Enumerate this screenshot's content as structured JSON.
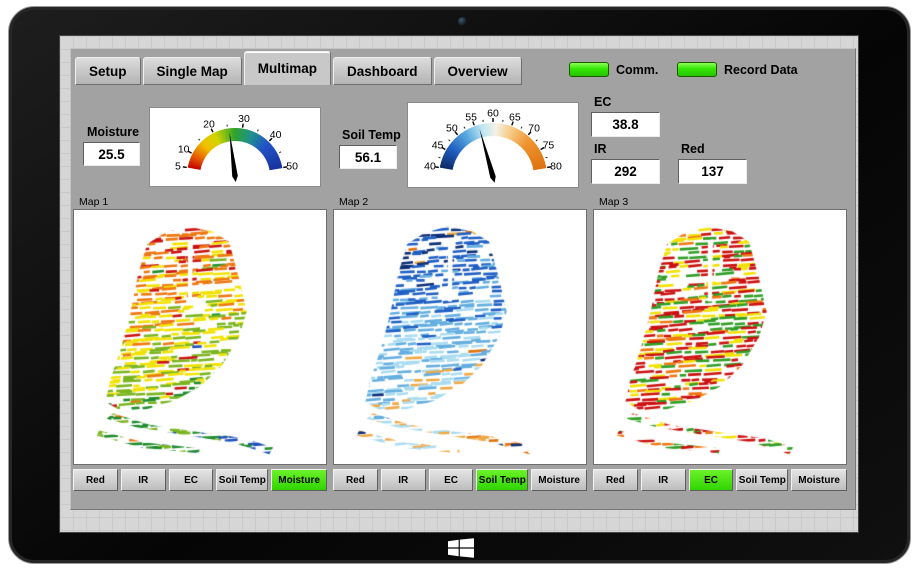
{
  "window": {
    "tabs": [
      {
        "label": "Setup"
      },
      {
        "label": "Single Map"
      },
      {
        "label": "Multimap"
      },
      {
        "label": "Dashboard"
      },
      {
        "label": "Overview"
      }
    ],
    "active_tab_index": 2
  },
  "indicators": [
    {
      "label": "Comm.",
      "state": "on",
      "color": "#33e604"
    },
    {
      "label": "Record Data",
      "state": "on",
      "color": "#33e604"
    }
  ],
  "readouts": {
    "moisture": {
      "label": "Moisture",
      "value": "25.5"
    },
    "soil_temp": {
      "label": "Soil Temp",
      "value": "56.1"
    },
    "ec": {
      "label": "EC",
      "value": "38.8"
    },
    "ir": {
      "label": "IR",
      "value": "292"
    },
    "red": {
      "label": "Red",
      "value": "137"
    }
  },
  "gauges": [
    {
      "id": "moisture-gauge",
      "min": 5,
      "max": 50,
      "value": 25.5,
      "major_ticks": [
        5,
        10,
        20,
        30,
        40,
        50
      ],
      "minor_step": 5,
      "band_stops": [
        [
          0,
          "#c40000"
        ],
        [
          0.1,
          "#e65c00"
        ],
        [
          0.22,
          "#f0c000"
        ],
        [
          0.34,
          "#cfd400"
        ],
        [
          0.5,
          "#2da32d"
        ],
        [
          0.64,
          "#1f9090"
        ],
        [
          0.78,
          "#2353c6"
        ],
        [
          1,
          "#16329e"
        ]
      ]
    },
    {
      "id": "soil-temp-gauge",
      "min": 40,
      "max": 80,
      "value": 56.1,
      "major_ticks": [
        40,
        45,
        50,
        55,
        60,
        65,
        70,
        75,
        80
      ],
      "minor_step": 2.5,
      "band_stops": [
        [
          0,
          "#0e2a66"
        ],
        [
          0.15,
          "#1f5ec0"
        ],
        [
          0.3,
          "#5aabdf"
        ],
        [
          0.42,
          "#bfe6f2"
        ],
        [
          0.52,
          "#f2f2e6"
        ],
        [
          0.62,
          "#f7cf8e"
        ],
        [
          0.78,
          "#ef9530"
        ],
        [
          1,
          "#e0720e"
        ]
      ]
    }
  ],
  "maps": {
    "buttons": [
      "Red",
      "IR",
      "EC",
      "Soil Temp",
      "Moisture"
    ],
    "items": [
      {
        "title": "Map 1",
        "selected_button": "Moisture",
        "distribution": "gradient",
        "seed": 7,
        "palette": [
          "#cc1010",
          "#ee7711",
          "#f2e205",
          "#7ab520",
          "#1f8c2c",
          "#1f4fbb"
        ],
        "weights": [
          0.28,
          0.14,
          0.26,
          0.16,
          0.1,
          0.06
        ]
      },
      {
        "title": "Map 2",
        "selected_button": "Soil Temp",
        "distribution": "gradient",
        "seed": 23,
        "palette": [
          "#0d2f77",
          "#1f5fc4",
          "#64aee0",
          "#aadcf0",
          "#f0a844",
          "#e0720e"
        ],
        "weights": [
          0.26,
          0.2,
          0.2,
          0.14,
          0.1,
          0.1
        ]
      },
      {
        "title": "Map 3",
        "selected_button": "EC",
        "distribution": "mixed",
        "seed": 41,
        "palette": [
          "#cc1010",
          "#f2e205",
          "#2f9e25",
          "#ee7711"
        ],
        "weights": [
          0.4,
          0.24,
          0.26,
          0.1
        ]
      }
    ]
  },
  "selected_button_color": "#3fdc00"
}
